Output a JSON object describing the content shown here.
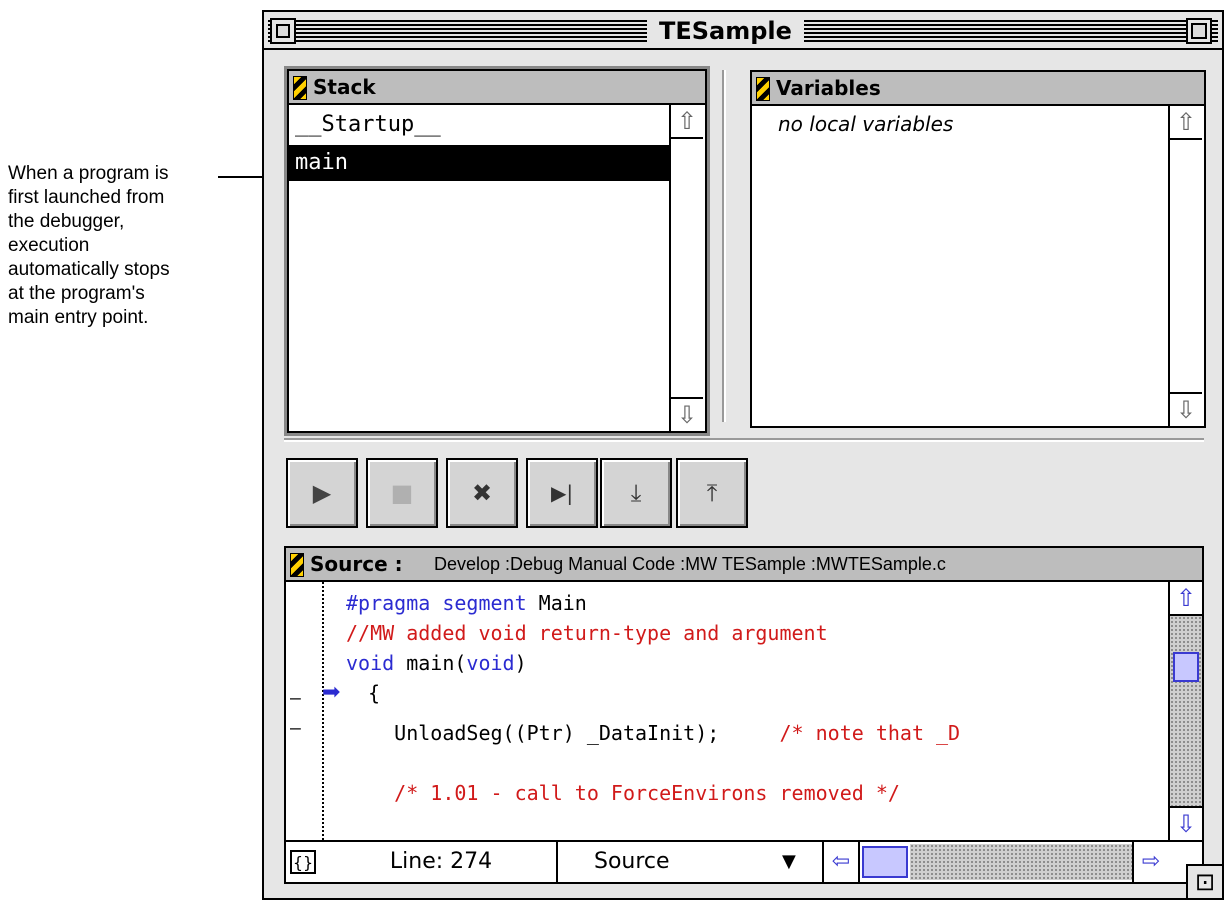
{
  "callout": {
    "lines": [
      "When a program is",
      "first launched from",
      "the debugger,",
      "execution",
      "automatically stops",
      "at the program's",
      "main entry point."
    ]
  },
  "window": {
    "title": "TESample"
  },
  "stack": {
    "title": "Stack",
    "rows": [
      "__Startup__",
      "main"
    ],
    "selected": "main"
  },
  "variables": {
    "title": "Variables",
    "empty_text": "no local variables"
  },
  "toolbar": {
    "run": "▶",
    "stop": "■",
    "kill": "✖",
    "step_over": "▶|",
    "step_into": "⤓",
    "step_out": "⤒"
  },
  "source": {
    "title": "Source :",
    "path": "Develop :Debug Manual Code :MW TESample :MWTESample.c",
    "lines": [
      {
        "kw": "#pragma segment",
        "tx": " Main",
        "cm": ""
      },
      {
        "kw": "",
        "tx": "",
        "cm": "//MW added void return-type and argument"
      },
      {
        "kw": "void",
        "tx": " main(",
        "kw2": "void",
        "tx2": ")"
      },
      {
        "kw": "",
        "tx": "{",
        "cm": ""
      },
      {
        "kw": "",
        "tx": "    UnloadSeg((Ptr) _DataInit);",
        "cm": "     /* note that _D"
      },
      {
        "kw": "",
        "tx": "",
        "cm": ""
      },
      {
        "kw": "",
        "tx": "    ",
        "cm": "/* 1.01 - call to ForceEnvirons removed */"
      }
    ],
    "status": {
      "braces": "{}",
      "line_label": "Line: 274",
      "view": "Source",
      "dropdown_arrow": "▼"
    }
  },
  "icons": {
    "up_arrow": "⇧",
    "down_arrow": "⇩",
    "left_arrow": "⇦",
    "right_arrow": "⇨",
    "pc_arrow": "➡",
    "zoom_box": "⊡"
  }
}
